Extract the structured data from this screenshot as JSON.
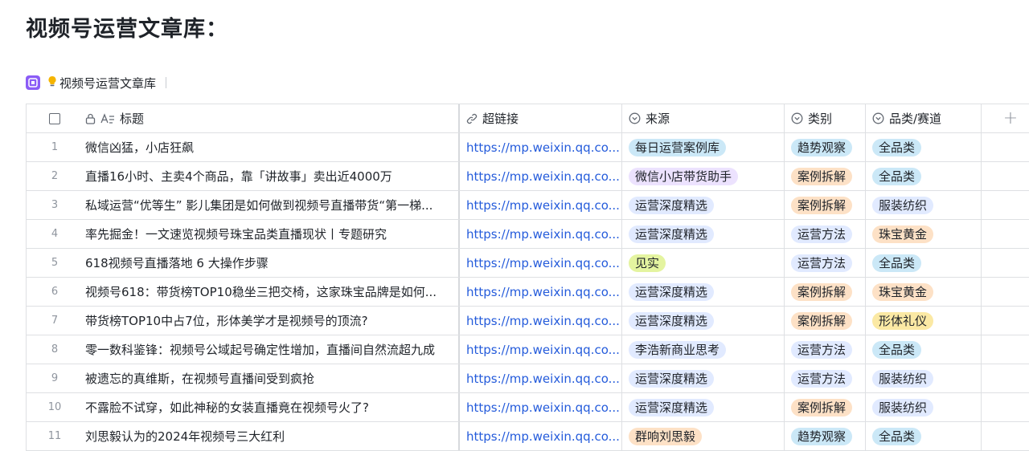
{
  "page": {
    "title": "视频号运营文章库："
  },
  "view": {
    "name": "视频号运营文章库"
  },
  "columns": {
    "title": "标题",
    "link": "超链接",
    "source": "来源",
    "category": "类别",
    "product": "品类/赛道",
    "add": "+"
  },
  "colors": {
    "link": "#245bdb",
    "tags": {
      "每日运营案例库": "#cbe8f7",
      "微信小店带货助手": "#ece2fe",
      "运营深度精选": "#e1eaff",
      "见实": "#e4f4a0",
      "李浩新商业思考": "#e1eaff",
      "群响刘思毅": "#fde1c6",
      "趋势观察": "#cbe8f7",
      "案例拆解": "#fde1c6",
      "运营方法": "#e1eaff",
      "全品类": "#cbe8f7",
      "服装纺织": "#e1eaff",
      "珠宝黄金": "#fde1c6",
      "形体礼仪": "#fbe9a4"
    }
  },
  "rows": [
    {
      "num": "1",
      "title": "微信凶猛，小店狂飙",
      "link": "https://mp.weixin.qq.co...",
      "source": "每日运营案例库",
      "category": "趋势观察",
      "product": "全品类"
    },
    {
      "num": "2",
      "title": "直播16小时、主卖4个商品，靠「讲故事」卖出近4000万",
      "link": "https://mp.weixin.qq.co...",
      "source": "微信小店带货助手",
      "category": "案例拆解",
      "product": "全品类"
    },
    {
      "num": "3",
      "title": "私域运营“优等生” 影儿集团是如何做到视频号直播带货“第一梯...",
      "link": "https://mp.weixin.qq.co...",
      "source": "运营深度精选",
      "category": "案例拆解",
      "product": "服装纺织"
    },
    {
      "num": "4",
      "title": "率先掘金！一文速览视频号珠宝品类直播现状丨专题研究",
      "link": "https://mp.weixin.qq.co...",
      "source": "运营深度精选",
      "category": "运营方法",
      "product": "珠宝黄金"
    },
    {
      "num": "5",
      "title": "618视频号直播落地 6 大操作步骤",
      "link": "https://mp.weixin.qq.co...",
      "source": "见实",
      "category": "运营方法",
      "product": "全品类"
    },
    {
      "num": "6",
      "title": "视频号618：带货榜TOP10稳坐三把交椅，这家珠宝品牌是如何...",
      "link": "https://mp.weixin.qq.co...",
      "source": "运营深度精选",
      "category": "案例拆解",
      "product": "珠宝黄金"
    },
    {
      "num": "7",
      "title": "带货榜TOP10中占7位，形体美学才是视频号的顶流?",
      "link": "https://mp.weixin.qq.co...",
      "source": "运营深度精选",
      "category": "案例拆解",
      "product": "形体礼仪"
    },
    {
      "num": "8",
      "title": "零一数科鉴锋：视频号公域起号确定性增加，直播间自然流超九成",
      "link": "https://mp.weixin.qq.co...",
      "source": "李浩新商业思考",
      "category": "运营方法",
      "product": "全品类"
    },
    {
      "num": "9",
      "title": "被遗忘的真维斯，在视频号直播间受到疯抢",
      "link": "https://mp.weixin.qq.co...",
      "source": "运营深度精选",
      "category": "运营方法",
      "product": "服装纺织"
    },
    {
      "num": "10",
      "title": "不露脸不试穿，如此神秘的女装直播竟在视频号火了?",
      "link": "https://mp.weixin.qq.co...",
      "source": "运营深度精选",
      "category": "案例拆解",
      "product": "服装纺织"
    },
    {
      "num": "11",
      "title": "刘思毅认为的2024年视频号三大红利",
      "link": "https://mp.weixin.qq.co...",
      "source": "群响刘思毅",
      "category": "趋势观察",
      "product": "全品类"
    }
  ]
}
